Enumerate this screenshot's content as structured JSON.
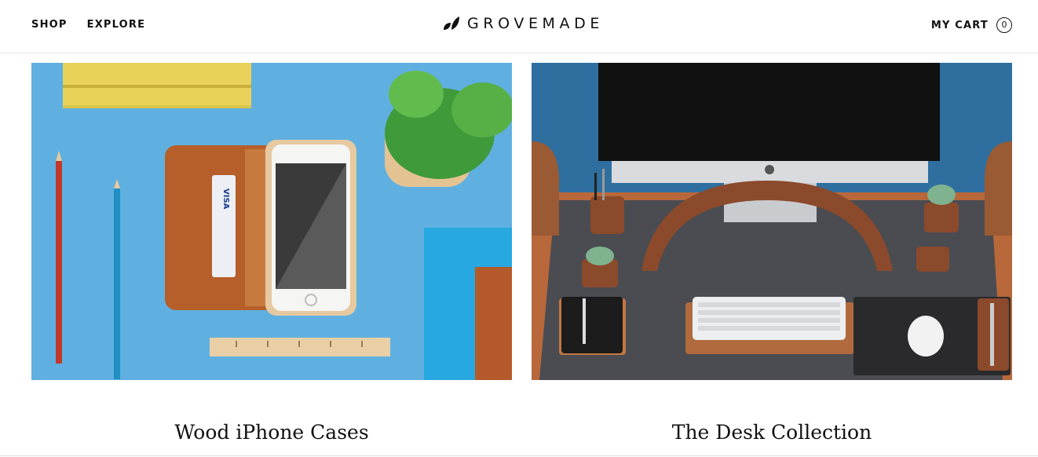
{
  "header": {
    "nav": [
      {
        "label": "SHOP"
      },
      {
        "label": "EXPLORE"
      }
    ],
    "logo_text": "GROVEMADE",
    "cart_label": "MY CART",
    "cart_count": "0"
  },
  "collections": [
    {
      "title": "Wood iPhone Cases",
      "image_alt": "wallet",
      "card_label": "VISA"
    },
    {
      "title": "The Desk Collection",
      "image_alt": "desk"
    }
  ],
  "colors": {
    "accent_blue": "#5fb0e0",
    "wood": "#8b4a2b",
    "text": "#111111"
  }
}
